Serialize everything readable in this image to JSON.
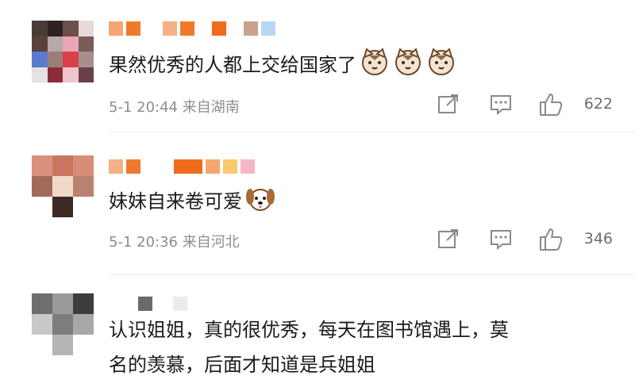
{
  "comments": [
    {
      "text": "果然优秀的人都上交给国家了",
      "time": "5-1 20:44",
      "location": "来自湖南",
      "likes": "622",
      "emoji_icons": [
        "cat-face-icon",
        "cat-face-icon",
        "cat-face-icon"
      ]
    },
    {
      "text": "妹妹自来卷可爱",
      "time": "5-1 20:36",
      "location": "来自河北",
      "likes": "346",
      "emoji_icons": [
        "dog-face-icon"
      ]
    },
    {
      "text_line1": "认识姐姐，真的很优秀，每天在图书馆遇上，莫",
      "text_line2": "名的羡慕，后面才知道是兵姐姐"
    }
  ],
  "icons": {
    "share": "share-icon",
    "comment": "comment-icon",
    "like": "thumbs-up-icon"
  },
  "colors": {
    "meta_text": "#8d8d8d",
    "icon_gray": "#8a8a8a",
    "name_orange": "#f07a2c"
  }
}
